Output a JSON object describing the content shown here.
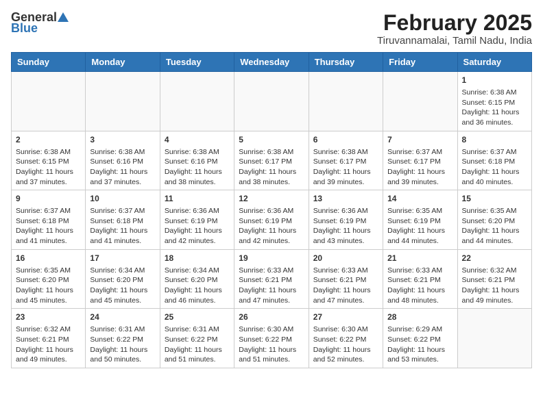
{
  "logo": {
    "general": "General",
    "blue": "Blue"
  },
  "title": "February 2025",
  "subtitle": "Tiruvannamalai, Tamil Nadu, India",
  "days_of_week": [
    "Sunday",
    "Monday",
    "Tuesday",
    "Wednesday",
    "Thursday",
    "Friday",
    "Saturday"
  ],
  "weeks": [
    [
      {
        "day": "",
        "info": ""
      },
      {
        "day": "",
        "info": ""
      },
      {
        "day": "",
        "info": ""
      },
      {
        "day": "",
        "info": ""
      },
      {
        "day": "",
        "info": ""
      },
      {
        "day": "",
        "info": ""
      },
      {
        "day": "1",
        "info": "Sunrise: 6:38 AM\nSunset: 6:15 PM\nDaylight: 11 hours\nand 36 minutes."
      }
    ],
    [
      {
        "day": "2",
        "info": "Sunrise: 6:38 AM\nSunset: 6:15 PM\nDaylight: 11 hours\nand 37 minutes."
      },
      {
        "day": "3",
        "info": "Sunrise: 6:38 AM\nSunset: 6:16 PM\nDaylight: 11 hours\nand 37 minutes."
      },
      {
        "day": "4",
        "info": "Sunrise: 6:38 AM\nSunset: 6:16 PM\nDaylight: 11 hours\nand 38 minutes."
      },
      {
        "day": "5",
        "info": "Sunrise: 6:38 AM\nSunset: 6:17 PM\nDaylight: 11 hours\nand 38 minutes."
      },
      {
        "day": "6",
        "info": "Sunrise: 6:38 AM\nSunset: 6:17 PM\nDaylight: 11 hours\nand 39 minutes."
      },
      {
        "day": "7",
        "info": "Sunrise: 6:37 AM\nSunset: 6:17 PM\nDaylight: 11 hours\nand 39 minutes."
      },
      {
        "day": "8",
        "info": "Sunrise: 6:37 AM\nSunset: 6:18 PM\nDaylight: 11 hours\nand 40 minutes."
      }
    ],
    [
      {
        "day": "9",
        "info": "Sunrise: 6:37 AM\nSunset: 6:18 PM\nDaylight: 11 hours\nand 41 minutes."
      },
      {
        "day": "10",
        "info": "Sunrise: 6:37 AM\nSunset: 6:18 PM\nDaylight: 11 hours\nand 41 minutes."
      },
      {
        "day": "11",
        "info": "Sunrise: 6:36 AM\nSunset: 6:19 PM\nDaylight: 11 hours\nand 42 minutes."
      },
      {
        "day": "12",
        "info": "Sunrise: 6:36 AM\nSunset: 6:19 PM\nDaylight: 11 hours\nand 42 minutes."
      },
      {
        "day": "13",
        "info": "Sunrise: 6:36 AM\nSunset: 6:19 PM\nDaylight: 11 hours\nand 43 minutes."
      },
      {
        "day": "14",
        "info": "Sunrise: 6:35 AM\nSunset: 6:19 PM\nDaylight: 11 hours\nand 44 minutes."
      },
      {
        "day": "15",
        "info": "Sunrise: 6:35 AM\nSunset: 6:20 PM\nDaylight: 11 hours\nand 44 minutes."
      }
    ],
    [
      {
        "day": "16",
        "info": "Sunrise: 6:35 AM\nSunset: 6:20 PM\nDaylight: 11 hours\nand 45 minutes."
      },
      {
        "day": "17",
        "info": "Sunrise: 6:34 AM\nSunset: 6:20 PM\nDaylight: 11 hours\nand 45 minutes."
      },
      {
        "day": "18",
        "info": "Sunrise: 6:34 AM\nSunset: 6:20 PM\nDaylight: 11 hours\nand 46 minutes."
      },
      {
        "day": "19",
        "info": "Sunrise: 6:33 AM\nSunset: 6:21 PM\nDaylight: 11 hours\nand 47 minutes."
      },
      {
        "day": "20",
        "info": "Sunrise: 6:33 AM\nSunset: 6:21 PM\nDaylight: 11 hours\nand 47 minutes."
      },
      {
        "day": "21",
        "info": "Sunrise: 6:33 AM\nSunset: 6:21 PM\nDaylight: 11 hours\nand 48 minutes."
      },
      {
        "day": "22",
        "info": "Sunrise: 6:32 AM\nSunset: 6:21 PM\nDaylight: 11 hours\nand 49 minutes."
      }
    ],
    [
      {
        "day": "23",
        "info": "Sunrise: 6:32 AM\nSunset: 6:21 PM\nDaylight: 11 hours\nand 49 minutes."
      },
      {
        "day": "24",
        "info": "Sunrise: 6:31 AM\nSunset: 6:22 PM\nDaylight: 11 hours\nand 50 minutes."
      },
      {
        "day": "25",
        "info": "Sunrise: 6:31 AM\nSunset: 6:22 PM\nDaylight: 11 hours\nand 51 minutes."
      },
      {
        "day": "26",
        "info": "Sunrise: 6:30 AM\nSunset: 6:22 PM\nDaylight: 11 hours\nand 51 minutes."
      },
      {
        "day": "27",
        "info": "Sunrise: 6:30 AM\nSunset: 6:22 PM\nDaylight: 11 hours\nand 52 minutes."
      },
      {
        "day": "28",
        "info": "Sunrise: 6:29 AM\nSunset: 6:22 PM\nDaylight: 11 hours\nand 53 minutes."
      },
      {
        "day": "",
        "info": ""
      }
    ]
  ]
}
